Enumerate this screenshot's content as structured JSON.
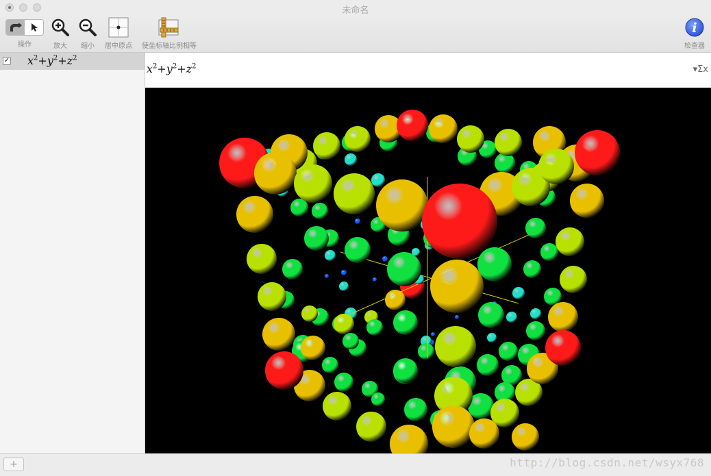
{
  "window": {
    "title": "未命名"
  },
  "toolbar": {
    "operate_label": "操作",
    "zoom_in_label": "放大",
    "zoom_out_label": "缩小",
    "center_label": "居中原点",
    "equal_axes_label": "使坐标轴比例相等",
    "inspector_label": "检查器"
  },
  "sidebar": {
    "items": [
      {
        "checked": true,
        "check_mark": "✓",
        "formula": {
          "x": "x",
          "sq": "2",
          "plus1": "+",
          "y": "y",
          "plus2": "+",
          "z": "z"
        }
      }
    ]
  },
  "formula_bar": {
    "formula": {
      "x": "x",
      "sq": "2",
      "plus1": "+",
      "y": "y",
      "plus2": "+",
      "z": "z"
    },
    "sigma_symbol": "▾Σx"
  },
  "plot": {
    "background": "#000000",
    "colors": {
      "red": "#ff1a1a",
      "yellow": "#e8c000",
      "yellowgreen": "#b8e000",
      "green": "#10e040",
      "cyan": "#20e0c8",
      "blue": "#1060ff",
      "axis": "#d8d000"
    }
  },
  "bottom": {
    "add_label": "+",
    "watermark": "http://blog.csdn.net/wsyx768"
  }
}
